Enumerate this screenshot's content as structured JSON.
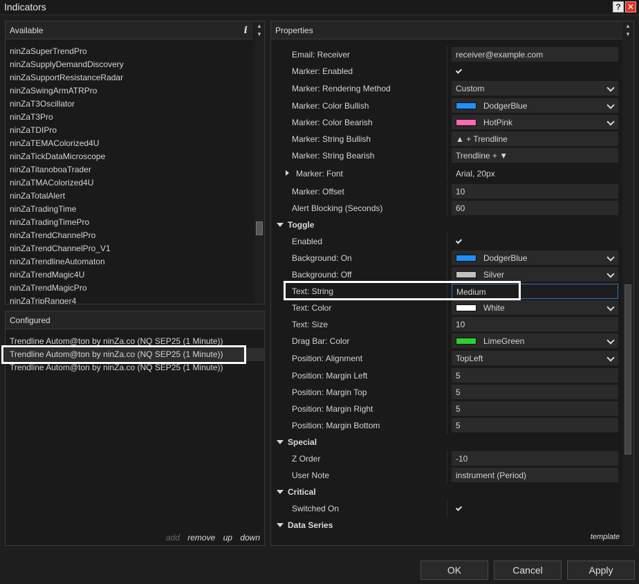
{
  "window": {
    "title": "Indicators",
    "help_icon": "?",
    "close_icon": "✕"
  },
  "available": {
    "header": "Available",
    "info_icon": "i",
    "items": [
      "ninZaSuperTrendPro",
      "ninZaSupplyDemandDiscovery",
      "ninZaSupportResistanceRadar",
      "ninZaSwingArmATRPro",
      "ninZaT3Oscillator",
      "ninZaT3Pro",
      "ninZaTDIPro",
      "ninZaTEMAColorized4U",
      "ninZaTickDataMicroscope",
      "ninZaTitanoboaTrader",
      "ninZaTMAColorized4U",
      "ninZaTotalAlert",
      "ninZaTradingTime",
      "ninZaTradingTimePro",
      "ninZaTrendChannelPro",
      "ninZaTrendChannelPro_V1",
      "ninZaTrendlineAutomaton",
      "ninZaTrendMagic4U",
      "ninZaTrendMagicPro",
      "ninZaTripRanger4"
    ]
  },
  "configured": {
    "header": "Configured",
    "items": [
      "Trendline Autom@ton by ninZa.co (NQ SEP25 (1 Minute))",
      "Trendline Autom@ton by ninZa.co (NQ SEP25 (1 Minute))",
      "Trendline Autom@ton by ninZa.co (NQ SEP25 (1 Minute))"
    ],
    "actions": {
      "add": "add",
      "remove": "remove",
      "up": "up",
      "down": "down"
    }
  },
  "properties": {
    "header": "Properties",
    "rows": {
      "email_receiver": {
        "label": "Email: Receiver",
        "value": "receiver@example.com"
      },
      "marker_enabled": {
        "label": "Marker: Enabled"
      },
      "marker_rendering": {
        "label": "Marker: Rendering Method",
        "value": "Custom"
      },
      "marker_color_bullish": {
        "label": "Marker: Color Bullish",
        "value": "DodgerBlue",
        "color": "#1e90ff"
      },
      "marker_color_bearish": {
        "label": "Marker: Color Bearish",
        "value": "HotPink",
        "color": "#ff69b4"
      },
      "marker_string_bullish": {
        "label": "Marker: String Bullish",
        "value": "▲ + Trendline"
      },
      "marker_string_bearish": {
        "label": "Marker: String Bearish",
        "value": "Trendline + ▼"
      },
      "marker_font": {
        "label": "Marker: Font",
        "value": "Arial, 20px"
      },
      "marker_offset": {
        "label": "Marker: Offset",
        "value": "10"
      },
      "alert_blocking": {
        "label": "Alert Blocking (Seconds)",
        "value": "60"
      },
      "cat_toggle": {
        "label": "Toggle"
      },
      "toggle_enabled": {
        "label": "Enabled"
      },
      "bg_on": {
        "label": "Background: On",
        "value": "DodgerBlue",
        "color": "#1e90ff"
      },
      "bg_off": {
        "label": "Background: Off",
        "value": "Silver",
        "color": "#c0c0c0"
      },
      "text_string": {
        "label": "Text: String",
        "value": "Medium"
      },
      "text_color": {
        "label": "Text: Color",
        "value": "White",
        "color": "#ffffff"
      },
      "text_size": {
        "label": "Text: Size",
        "value": "10"
      },
      "drag_bar_color": {
        "label": "Drag Bar: Color",
        "value": "LimeGreen",
        "color": "#32cd32"
      },
      "pos_alignment": {
        "label": "Position: Alignment",
        "value": "TopLeft"
      },
      "pos_margin_left": {
        "label": "Position: Margin Left",
        "value": "5"
      },
      "pos_margin_top": {
        "label": "Position: Margin Top",
        "value": "5"
      },
      "pos_margin_right": {
        "label": "Position: Margin Right",
        "value": "5"
      },
      "pos_margin_bottom": {
        "label": "Position: Margin Bottom",
        "value": "5"
      },
      "cat_special": {
        "label": "Special"
      },
      "z_order": {
        "label": "Z Order",
        "value": "-10"
      },
      "user_note": {
        "label": "User Note",
        "value": "instrument (Period)"
      },
      "cat_critical": {
        "label": "Critical"
      },
      "switched_on": {
        "label": "Switched On"
      },
      "cat_data_series": {
        "label": "Data Series"
      }
    },
    "template_link": "template"
  },
  "buttons": {
    "ok": "OK",
    "cancel": "Cancel",
    "apply": "Apply"
  }
}
